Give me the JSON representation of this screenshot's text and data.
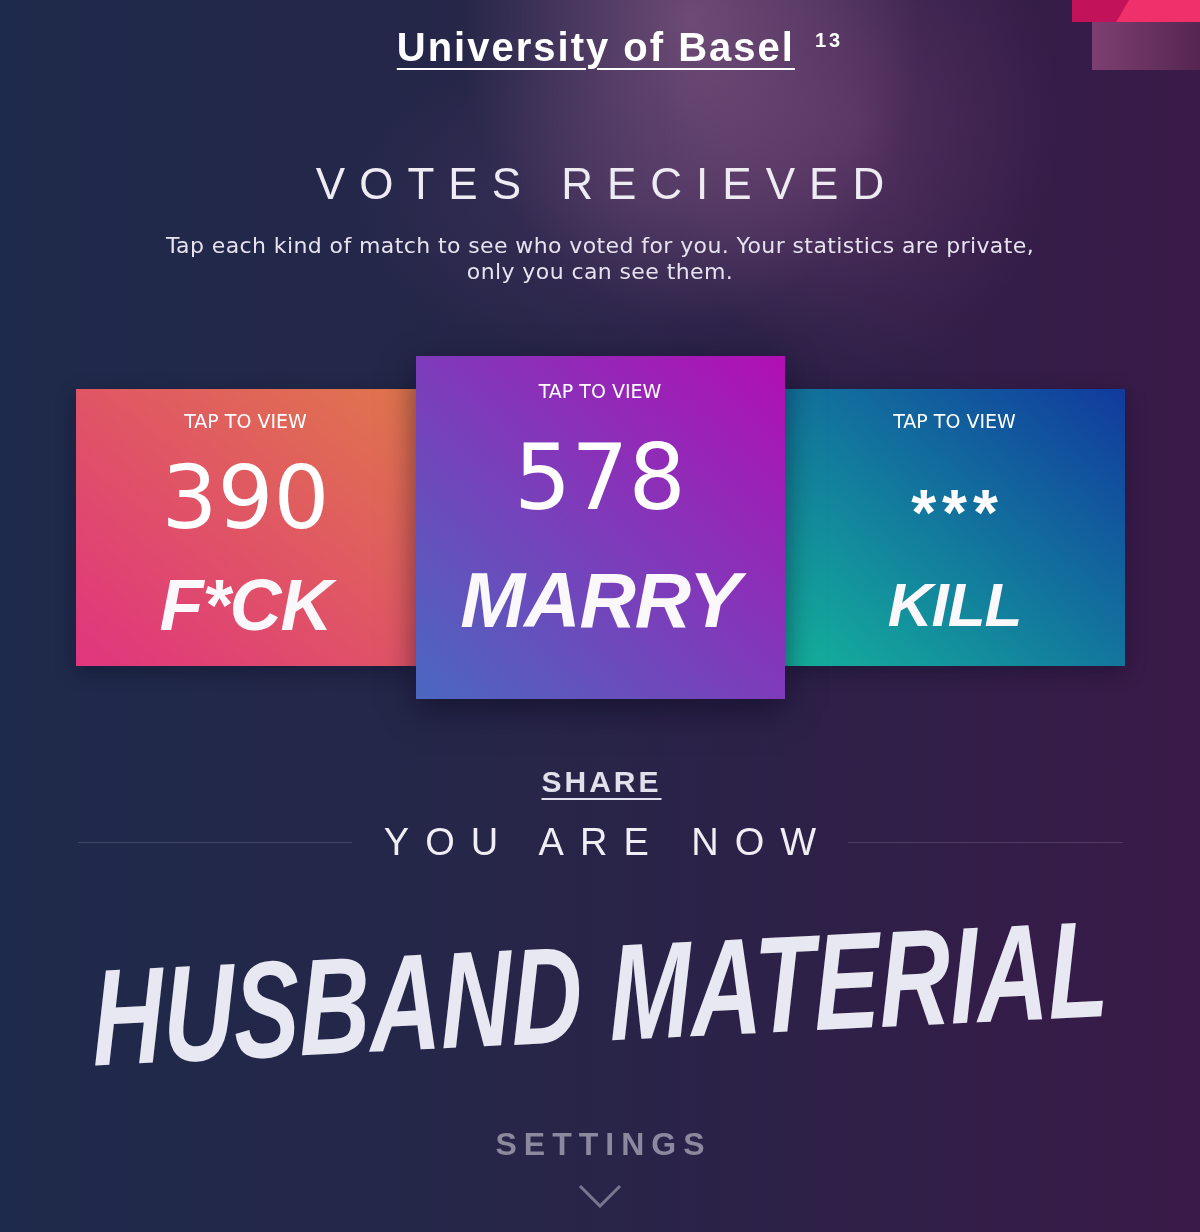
{
  "header": {
    "title": "University of Basel",
    "badge": "13"
  },
  "votes": {
    "heading": "VOTES RECIEVED",
    "description": "Tap each kind of match to see who voted for you. Your statistics are private, only you can see them."
  },
  "cards": [
    {
      "hint": "TAP TO VIEW",
      "count": "390",
      "masked": false,
      "label": "F*CK",
      "selected": false,
      "stops": [
        {
          "color": "#e0357e"
        },
        {
          "color": "#e0764c"
        }
      ]
    },
    {
      "hint": "TAP TO VIEW",
      "count": "578",
      "masked": false,
      "label": "MARRY",
      "selected": true,
      "stops": [
        {
          "color": "#4a68c0"
        },
        {
          "color": "#b20eb4"
        }
      ]
    },
    {
      "hint": "TAP TO VIEW",
      "count": "***",
      "masked": true,
      "label": "KILL",
      "selected": false,
      "stops": [
        {
          "color": "#14b29c"
        },
        {
          "color": "#113a9e"
        }
      ]
    }
  ],
  "share": {
    "label": "SHARE"
  },
  "result": {
    "heading": "YOU ARE NOW",
    "title": "HUSBAND MATERIAL"
  },
  "settings": {
    "label": "SETTINGS"
  }
}
